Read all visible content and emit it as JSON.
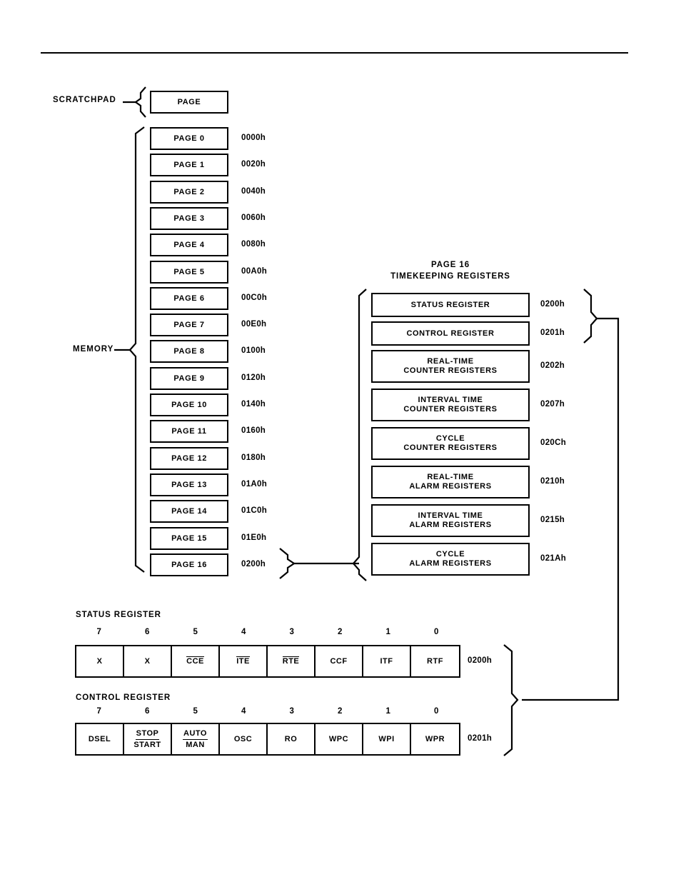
{
  "diagram": {
    "scratchpad": {
      "label": "SCRATCHPAD",
      "box": "PAGE"
    },
    "memory": {
      "label": "MEMORY",
      "pages": [
        {
          "name": "PAGE 0",
          "address": "0000h"
        },
        {
          "name": "PAGE 1",
          "address": "0020h"
        },
        {
          "name": "PAGE 2",
          "address": "0040h"
        },
        {
          "name": "PAGE 3",
          "address": "0060h"
        },
        {
          "name": "PAGE 4",
          "address": "0080h"
        },
        {
          "name": "PAGE 5",
          "address": "00A0h"
        },
        {
          "name": "PAGE 6",
          "address": "00C0h"
        },
        {
          "name": "PAGE 7",
          "address": "00E0h"
        },
        {
          "name": "PAGE 8",
          "address": "0100h"
        },
        {
          "name": "PAGE 9",
          "address": "0120h"
        },
        {
          "name": "PAGE 10",
          "address": "0140h"
        },
        {
          "name": "PAGE 11",
          "address": "0160h"
        },
        {
          "name": "PAGE 12",
          "address": "0180h"
        },
        {
          "name": "PAGE 13",
          "address": "01A0h"
        },
        {
          "name": "PAGE 14",
          "address": "01C0h"
        },
        {
          "name": "PAGE 15",
          "address": "01E0h"
        },
        {
          "name": "PAGE 16",
          "address": "0200h"
        }
      ]
    },
    "timekeeping": {
      "title_line1": "PAGE 16",
      "title_line2": "TIMEKEEPING REGISTERS",
      "registers": [
        {
          "line1": "STATUS REGISTER",
          "line2": "",
          "address": "0200h"
        },
        {
          "line1": "CONTROL REGISTER",
          "line2": "",
          "address": "0201h"
        },
        {
          "line1": "REAL-TIME",
          "line2": "COUNTER REGISTERS",
          "address": "0202h"
        },
        {
          "line1": "INTERVAL TIME",
          "line2": "COUNTER REGISTERS",
          "address": "0207h"
        },
        {
          "line1": "CYCLE",
          "line2": "COUNTER REGISTERS",
          "address": "020Ch"
        },
        {
          "line1": "REAL-TIME",
          "line2": "ALARM REGISTERS",
          "address": "0210h"
        },
        {
          "line1": "INTERVAL TIME",
          "line2": "ALARM REGISTERS",
          "address": "0215h"
        },
        {
          "line1": "CYCLE",
          "line2": "ALARM REGISTERS",
          "address": "021Ah"
        }
      ]
    },
    "status_register": {
      "caption": "STATUS REGISTER",
      "address": "0200h",
      "bit_numbers": [
        "7",
        "6",
        "5",
        "4",
        "3",
        "2",
        "1",
        "0"
      ],
      "bits": [
        {
          "label": "X",
          "style": "plain"
        },
        {
          "label": "X",
          "style": "plain"
        },
        {
          "label": "CCE",
          "style": "overline"
        },
        {
          "label": "ITE",
          "style": "overline"
        },
        {
          "label": "RTE",
          "style": "overline"
        },
        {
          "label": "CCF",
          "style": "plain"
        },
        {
          "label": "ITF",
          "style": "plain"
        },
        {
          "label": "RTF",
          "style": "plain"
        }
      ]
    },
    "control_register": {
      "caption": "CONTROL REGISTER",
      "address": "0201h",
      "bit_numbers": [
        "7",
        "6",
        "5",
        "4",
        "3",
        "2",
        "1",
        "0"
      ],
      "bits": [
        {
          "label": "DSEL",
          "style": "plain"
        },
        {
          "label": "STOP",
          "label2": "START",
          "style": "fraction"
        },
        {
          "label": "AUTO",
          "label2": "MAN",
          "style": "fraction"
        },
        {
          "label": "OSC",
          "style": "plain"
        },
        {
          "label": "RO",
          "style": "plain"
        },
        {
          "label": "WPC",
          "style": "plain"
        },
        {
          "label": "WPI",
          "style": "plain"
        },
        {
          "label": "WPR",
          "style": "plain"
        }
      ]
    },
    "colors": {
      "ink": "#000000",
      "paper": "#ffffff"
    }
  }
}
